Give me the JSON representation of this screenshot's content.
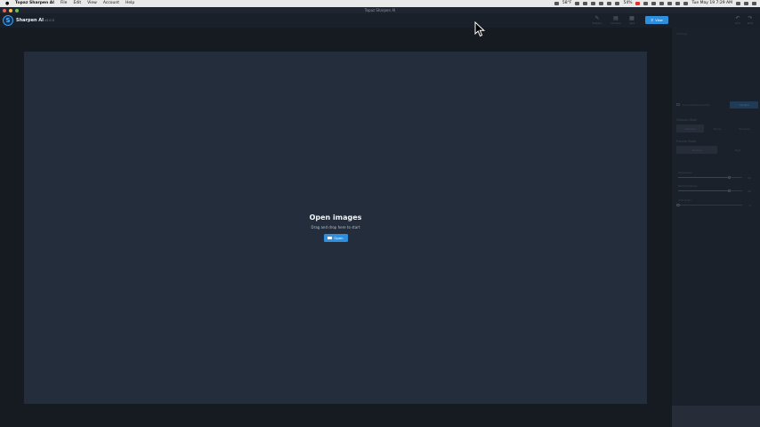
{
  "menubar": {
    "app_name": "Topaz Sharpen AI",
    "items": [
      "File",
      "Edit",
      "View",
      "Account",
      "Help"
    ],
    "status": {
      "temperature": "58°F",
      "battery": "54%",
      "datetime": "Tue May 19 7:29 AM"
    }
  },
  "window": {
    "title": "Topaz Sharpen AI"
  },
  "header": {
    "brand": "Sharpen AI",
    "version": "v2.0.5",
    "tools": [
      {
        "label": "Sharpen",
        "icon": "brush-icon"
      },
      {
        "label": "Compare",
        "icon": "compare-icon"
      },
      {
        "label": "Split",
        "icon": "grid-icon"
      }
    ],
    "view_button": "View",
    "undo_label": "Undo",
    "redo_label": "Redo"
  },
  "canvas": {
    "title": "Open images",
    "subtitle": "Drag and drop here to start",
    "open_button": "Open"
  },
  "panel": {
    "title": "Settings",
    "auto_update_label": "Auto update preview",
    "update_button": "Update",
    "sharpen_mode_label": "Sharpen Mode",
    "sharpen_modes": [
      "Stabilize",
      "Focus",
      "Sharpen"
    ],
    "process_mode_label": "Process Mode",
    "process_modes": [
      "Normal",
      "Fast"
    ],
    "sliders": [
      {
        "label": "Sharpness",
        "value": 0.8,
        "display": "40"
      },
      {
        "label": "Remove Noise",
        "value": 0.8,
        "display": "40"
      },
      {
        "label": "Add Grain",
        "value": 0.0,
        "display": "0"
      }
    ]
  },
  "colors": {
    "accent": "#2f8fdf",
    "canvas_bg": "#242d3b",
    "app_bg": "#161b22"
  }
}
